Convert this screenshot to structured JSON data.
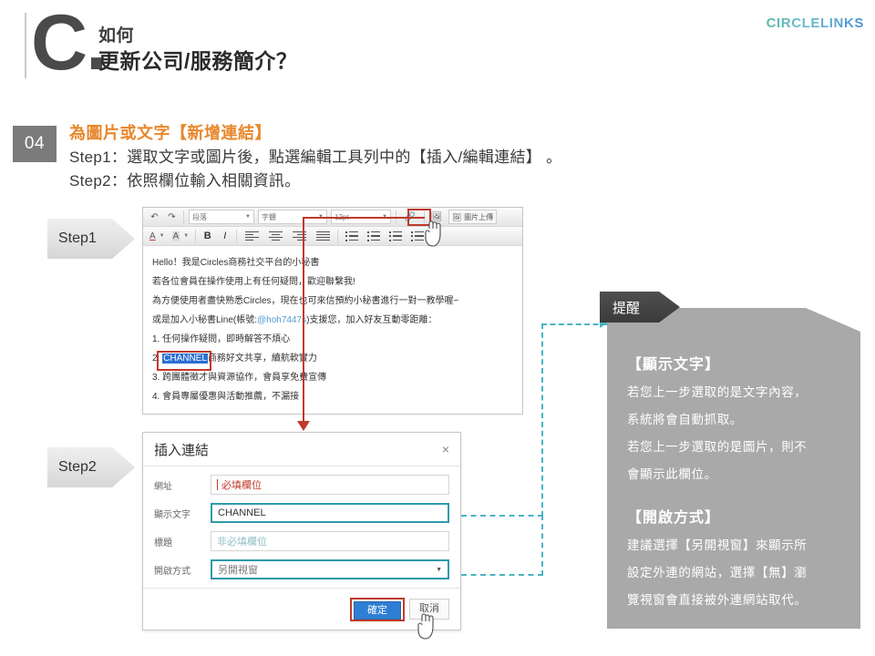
{
  "header": {
    "letter": "C.",
    "line1": "如何",
    "line2": "更新公司/服務簡介？",
    "brand": "CIRCLELINKS",
    "accent_orange": "#e8872b",
    "accent_teal": "#4bb3c3",
    "accent_red": "#c0392b"
  },
  "step_block": {
    "number": "04",
    "heading": "為圖片或文字【新增連結】",
    "line1": "Step1：選取文字或圖片後，點選編輯工具列中的【插入/編輯連結】 。",
    "line2": "Step2：依照欄位輸入相關資訊。"
  },
  "tags": {
    "step1": "Step1",
    "step2": "Step2",
    "note": "提醒"
  },
  "editor": {
    "toolbar_row1": {
      "undo_icon": "undo-arrow",
      "redo_icon": "redo-arrow",
      "paragraph_select": "段落",
      "font_select": "字體",
      "size_select": "12pt",
      "link_icon": "chain-link-icon",
      "image_icon": "image-icon",
      "upload_button": "圖片上傳"
    },
    "toolbar_row2": {
      "text_color": "A",
      "bg_color": "A",
      "bold": "B",
      "italic": "I",
      "align_left": "align-left-icon",
      "align_center": "align-center-icon",
      "align_right": "align-right-icon",
      "align_justify": "align-justify-icon",
      "bullet_list": "bullet-list-icon",
      "number_list": "number-list-icon",
      "outdent": "outdent-icon",
      "indent": "indent-icon"
    },
    "content_lines": [
      "Hello！我是Circles商務社交平台的小秘書",
      "若各位會員在操作使用上有任何疑問，歡迎聯繫我!",
      "為方便使用者盡快熟悉Circles，現在也可來信預約小秘書進行一對一教學喔~"
    ],
    "line4_prefix": "或是加入小秘書Line(帳號:",
    "line4_link": "@hoh7447s",
    "line4_suffix": ")支援您，加入好友互動零距離：",
    "list_item_1": "1. 任何操作疑問，即時解答不煩心",
    "list_item_2_num": "2. ",
    "list_item_2_sel": "CHANNEL",
    "list_item_2_rest": "商務好文共享，續航軟實力",
    "list_item_3": "3. 跨團體徵才與資源協作，會員享免費宣傳",
    "list_item_4": "4. 會員專屬優惠與活動推薦，不漏接"
  },
  "dialog": {
    "title": "插入連結",
    "close": "×",
    "fields": [
      {
        "label": "網址",
        "value": "",
        "placeholder": "必填欄位",
        "type": "text",
        "highlight": false
      },
      {
        "label": "顯示文字",
        "value": "CHANNEL",
        "placeholder": "",
        "type": "text",
        "highlight": true
      },
      {
        "label": "標題",
        "value": "",
        "placeholder": "非必填欄位",
        "type": "text",
        "highlight": false
      },
      {
        "label": "開啟方式",
        "value": "另開視窗",
        "placeholder": "",
        "type": "select",
        "highlight": true
      }
    ],
    "confirm_label": "確定",
    "cancel_label": "取消"
  },
  "note": {
    "heading1": "【顯示文字】",
    "body1_line1": "若您上一步選取的是文字內容，",
    "body1_line2": "系統將會自動抓取。",
    "body1_line3": "若您上一步選取的是圖片，則不",
    "body1_line4": "會顯示此欄位。",
    "heading2": "【開啟方式】",
    "body2_line1": "建議選擇【另開視窗】來顯示所",
    "body2_line2": "設定外連的網站，選擇【無】瀏",
    "body2_line3": "覽視窗會直接被外連網站取代。"
  }
}
